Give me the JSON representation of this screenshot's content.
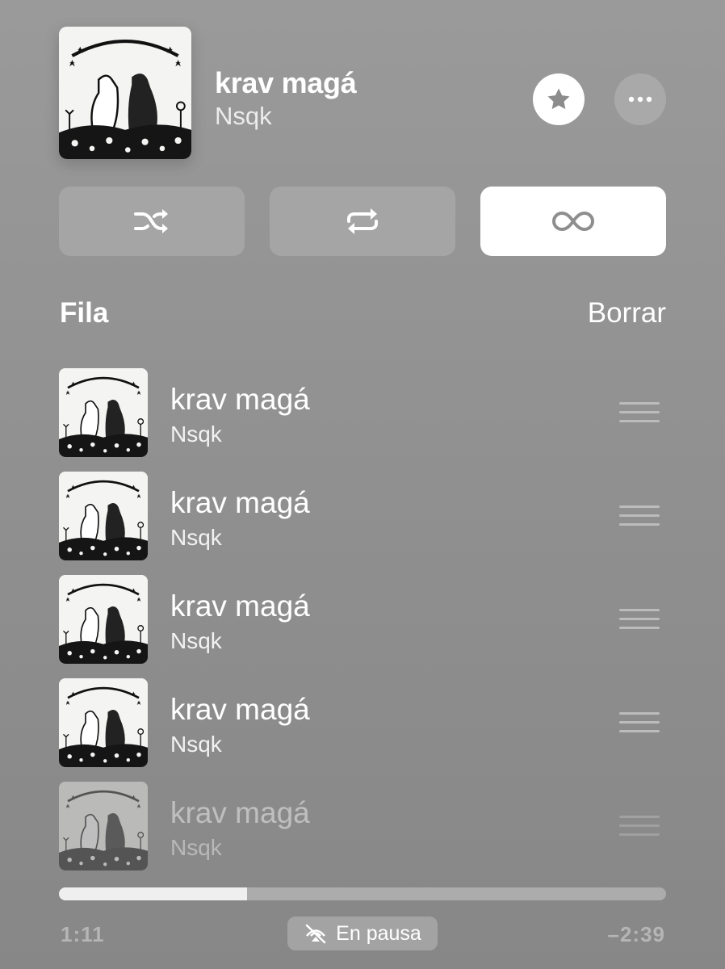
{
  "now_playing": {
    "title": "krav magá",
    "artist": "Nsqk",
    "artwork_icon": "album-artwork-dogs"
  },
  "actions": {
    "favorite_icon": "star-icon",
    "more_icon": "ellipsis-icon"
  },
  "modes": [
    {
      "icon": "shuffle-icon",
      "active": false
    },
    {
      "icon": "repeat-icon",
      "active": false
    },
    {
      "icon": "infinity-icon",
      "active": true
    }
  ],
  "queue": {
    "heading": "Fila",
    "clear_label": "Borrar",
    "items": [
      {
        "title": "krav magá",
        "artist": "Nsqk"
      },
      {
        "title": "krav magá",
        "artist": "Nsqk"
      },
      {
        "title": "krav magá",
        "artist": "Nsqk"
      },
      {
        "title": "krav magá",
        "artist": "Nsqk"
      },
      {
        "title": "krav magá",
        "artist": "Nsqk"
      }
    ]
  },
  "playback": {
    "elapsed": "1:11",
    "remaining": "–2:39",
    "progress_fraction": 0.31,
    "status_label": "En pausa",
    "status_icon": "airplay-off-icon"
  },
  "colors": {
    "background": "#949494",
    "active_button": "#ffffff",
    "inactive_button": "#a5a5a5",
    "progress_fill": "#efefef"
  }
}
